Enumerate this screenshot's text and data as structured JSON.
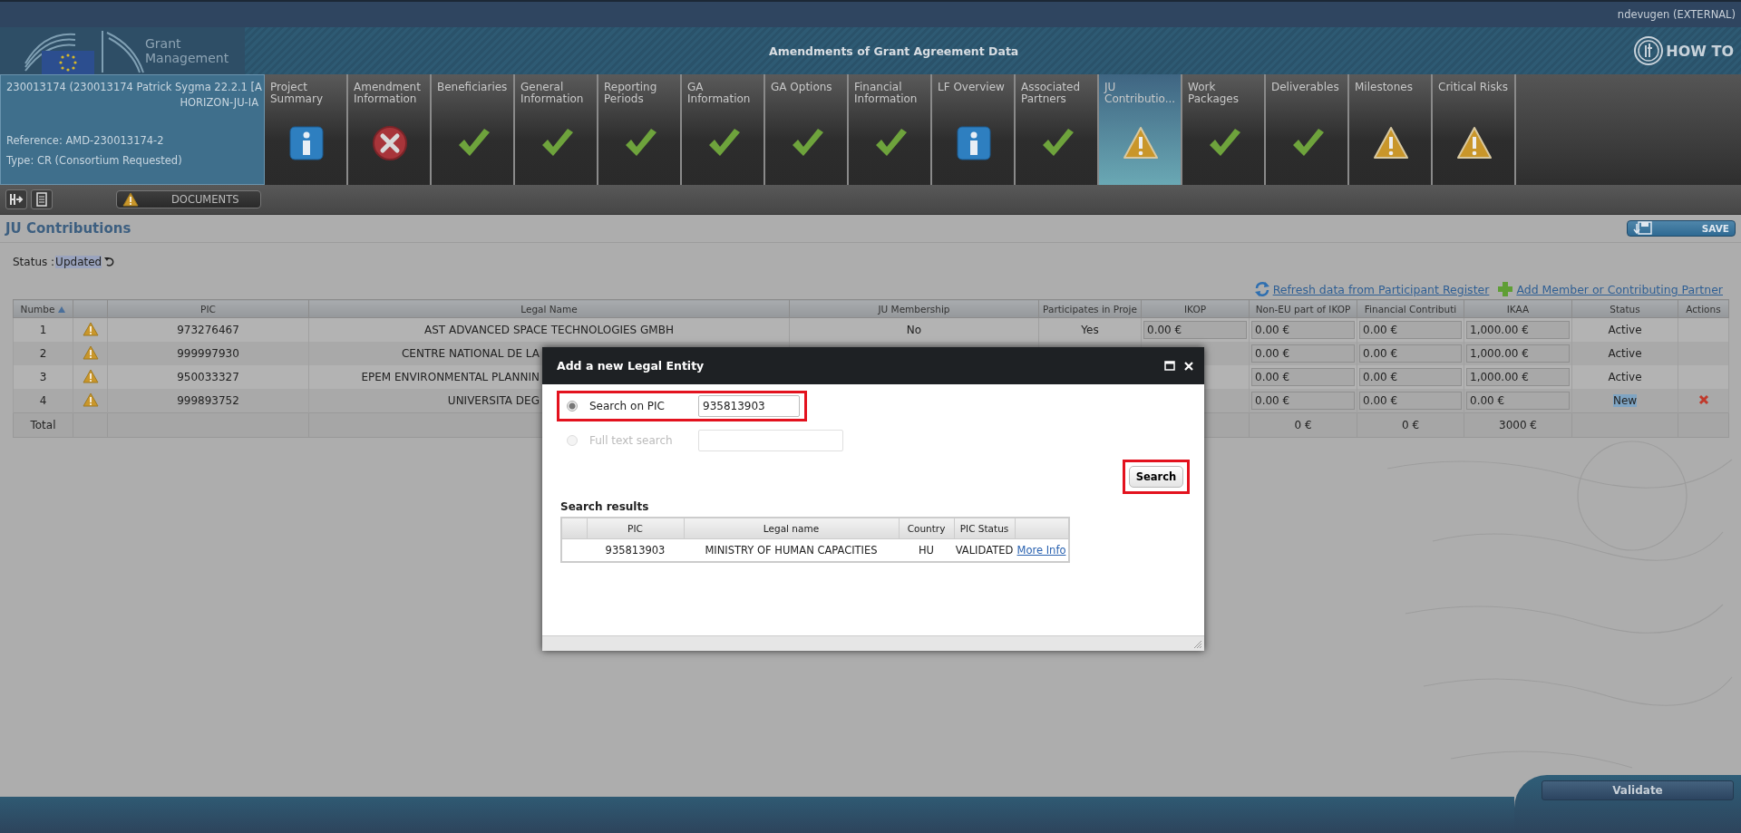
{
  "top_bar": {
    "user": "ndevugen (EXTERNAL)"
  },
  "header": {
    "brand": "Grant Management",
    "title": "Amendments of Grant Agreement Data",
    "help": "HOW TO"
  },
  "project": {
    "line_1": "230013174 (230013174 Patrick Sygma 22.2.1 [A",
    "line_2": "HORIZON-JU-IA",
    "reference": "Reference: AMD-230013174-2",
    "type": "Type: CR (Consortium Requested)"
  },
  "tabs": [
    {
      "label": "Project Summary",
      "kind": "info",
      "selected": false
    },
    {
      "label": "Amendment Information",
      "kind": "error",
      "selected": false
    },
    {
      "label": "Beneficiaries",
      "kind": "ok",
      "selected": false
    },
    {
      "label": "General Information",
      "kind": "ok",
      "selected": false
    },
    {
      "label": "Reporting Periods",
      "kind": "ok",
      "selected": false
    },
    {
      "label": "GA Information",
      "kind": "ok",
      "selected": false
    },
    {
      "label": "GA Options",
      "kind": "ok",
      "selected": false
    },
    {
      "label": "Financial Information",
      "kind": "ok",
      "selected": false
    },
    {
      "label": "LF Overview",
      "kind": "info",
      "selected": false
    },
    {
      "label": "Associated Partners",
      "kind": "ok",
      "selected": false
    },
    {
      "label": "JU Contributio...",
      "kind": "warning",
      "selected": true
    },
    {
      "label": "Work Packages",
      "kind": "ok",
      "selected": false
    },
    {
      "label": "Deliverables",
      "kind": "ok",
      "selected": false
    },
    {
      "label": "Milestones",
      "kind": "warning",
      "selected": false
    },
    {
      "label": "Critical Risks",
      "kind": "warning",
      "selected": false
    }
  ],
  "toolbar": {
    "documents": "DOCUMENTS"
  },
  "page": {
    "title": "JU Contributions",
    "save": "SAVE",
    "status_label": "Status :",
    "status_value": "Updated"
  },
  "links": [
    "Refresh data from Participant Register",
    "Add Member or Contributing Partner"
  ],
  "table": {
    "columns": [
      "Numbe",
      "PIC",
      "Legal Name",
      "JU Membership",
      "Participates in Proje",
      "IKOP",
      "Non-EU part of IKOP",
      "Financial Contributi",
      "IKAA",
      "Status",
      "Actions"
    ],
    "rows": [
      {
        "number": "1",
        "warning": true,
        "pic": "973276467",
        "legal_name": "AST ADVANCED SPACE TECHNOLOGIES GMBH",
        "ju_membership": "No",
        "participates": "Yes",
        "ikop": "0.00 €",
        "non_eu_ikop": "0.00 €",
        "financial": "0.00 €",
        "ikaa": "1,000.00 €",
        "status": "Active",
        "is_new": false,
        "removable": false
      },
      {
        "number": "2",
        "warning": true,
        "pic": "999997930",
        "legal_name": "CENTRE NATIONAL DE LA",
        "non_eu_ikop": "0.00 €",
        "financial": "0.00 €",
        "ikaa": "1,000.00 €",
        "status": "Active",
        "is_new": false,
        "removable": false
      },
      {
        "number": "3",
        "warning": true,
        "pic": "950033327",
        "legal_name": "EPEM ENVIRONMENTAL PLANNIN",
        "non_eu_ikop": "0.00 €",
        "financial": "0.00 €",
        "ikaa": "1,000.00 €",
        "status": "Active",
        "is_new": false,
        "removable": false
      },
      {
        "number": "4",
        "warning": true,
        "pic": "999893752",
        "legal_name": "UNIVERSITA DEG",
        "non_eu_ikop": "0.00 €",
        "financial": "0.00 €",
        "ikaa": "0.00 €",
        "status": "New",
        "is_new": true,
        "removable": true
      }
    ],
    "total": {
      "label": "Total",
      "non_eu_ikop": "0 €",
      "financial": "0 €",
      "ikaa": "3000 €"
    }
  },
  "dialog": {
    "title": "Add a new Legal Entity",
    "options": [
      {
        "label": "Search on PIC",
        "value": "935813903",
        "selected": true,
        "disabled": false,
        "highlighted": true
      },
      {
        "label": "Full text search",
        "selected": false,
        "disabled": true,
        "highlighted": false
      }
    ],
    "search_button": {
      "label": "Search",
      "highlighted": true
    },
    "results_title": "Search results",
    "results": {
      "columns": [
        "PIC",
        "Legal name",
        "Country",
        "PIC Status"
      ],
      "rows": [
        {
          "pic": "935813903",
          "legal_name": "MINISTRY OF HUMAN CAPACITIES",
          "country": "HU",
          "pic_status": "VALIDATED",
          "link": "More Info"
        }
      ]
    }
  },
  "footer": {
    "validate": "Validate"
  }
}
